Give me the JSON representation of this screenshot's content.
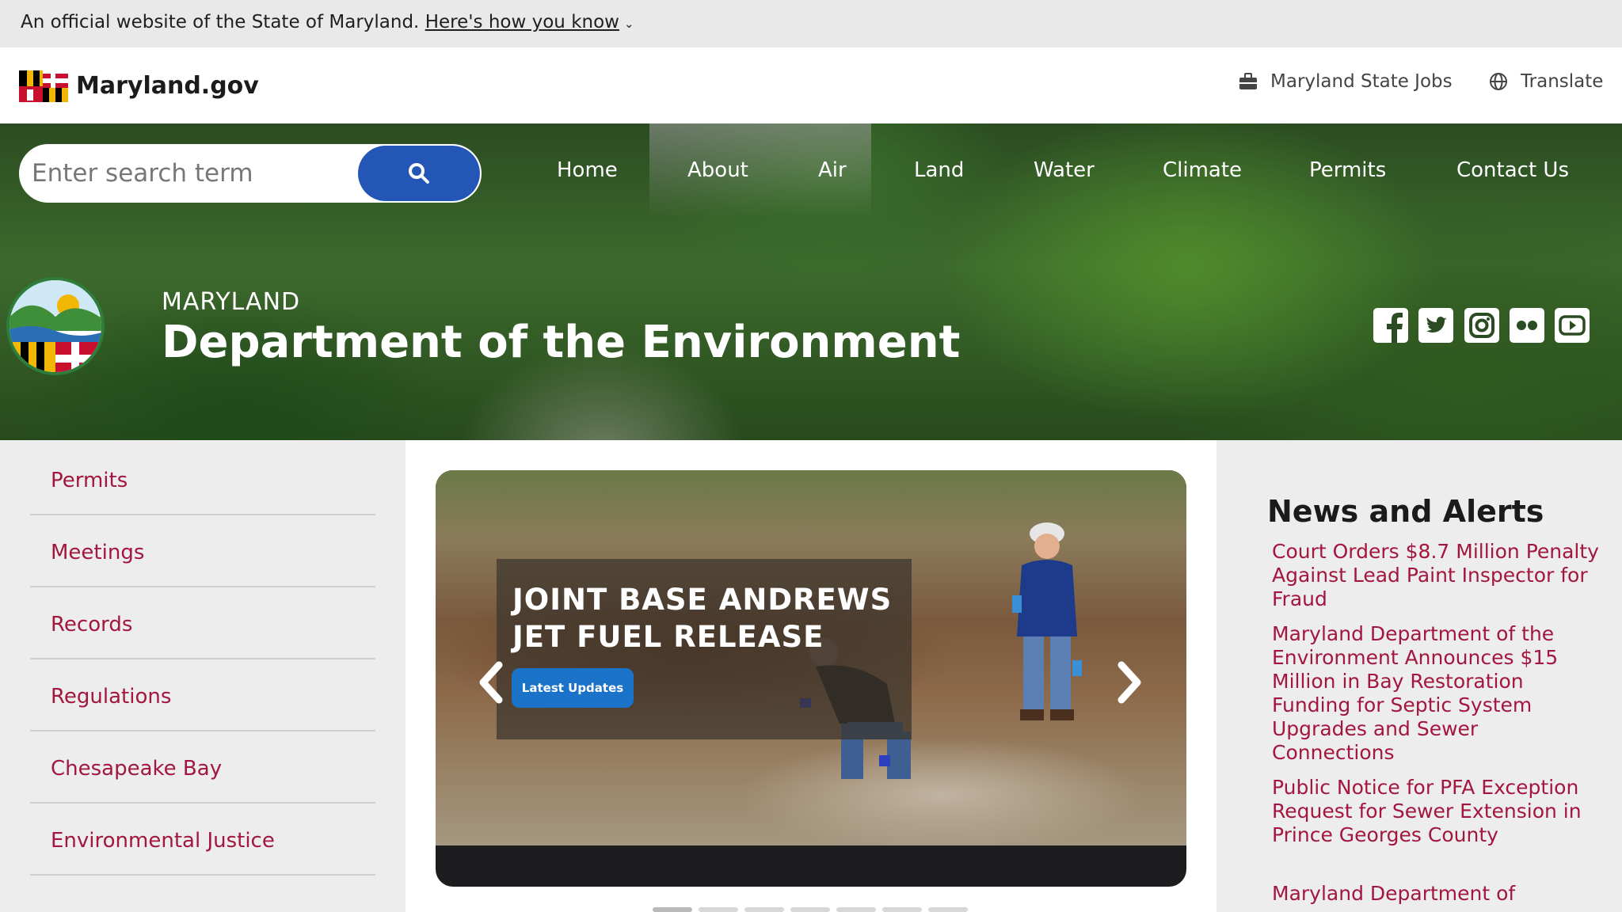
{
  "official_banner": {
    "text": "An official website of the State of Maryland.",
    "link_label": "Here's how you know",
    "chevron": "⌄"
  },
  "header": {
    "site_title": "Maryland.gov",
    "jobs_label": "Maryland State Jobs",
    "translate_label": "Translate",
    "icons": {
      "jobs": "briefcase-icon",
      "translate": "globe-icon",
      "logo": "maryland-flag-logo"
    }
  },
  "search": {
    "placeholder": "Enter search term",
    "button_icon": "search-icon"
  },
  "nav": {
    "items": [
      {
        "label": "Home"
      },
      {
        "label": "About"
      },
      {
        "label": "Air"
      },
      {
        "label": "Land"
      },
      {
        "label": "Water"
      },
      {
        "label": "Climate"
      },
      {
        "label": "Permits"
      },
      {
        "label": "Contact Us"
      }
    ]
  },
  "department": {
    "kicker": "MARYLAND",
    "title": "Department of the Environment",
    "seal": "mde-seal-logo"
  },
  "social": [
    "facebook-icon",
    "twitter-icon",
    "instagram-icon",
    "flickr-icon",
    "youtube-icon"
  ],
  "sidebar": {
    "items": [
      {
        "label": "Permits"
      },
      {
        "label": "Meetings"
      },
      {
        "label": "Records"
      },
      {
        "label": "Regulations"
      },
      {
        "label": "Chesapeake Bay"
      },
      {
        "label": "Environmental Justice"
      }
    ]
  },
  "carousel": {
    "caption_line1": "JOINT BASE ANDREWS",
    "caption_line2": "JET FUEL RELEASE",
    "button_label": "Latest Updates",
    "slide_count": 7,
    "active_index": 0
  },
  "news": {
    "title": "News and Alerts",
    "items": [
      {
        "headline": "Court Orders $8.7 Million Penalty Against Lead Paint Inspector for Fraud"
      },
      {
        "headline": "Maryland Department of the Environment Announces $15 Million in Bay Restoration Funding for Septic System Upgrades and Sewer Connections"
      },
      {
        "headline": "Public Notice for PFA Exception Request for Sewer Extension in Prince Georges County"
      },
      {
        "headline": "Maryland Department of"
      }
    ]
  },
  "colors": {
    "accent_blue": "#2456b8",
    "link_maroon": "#a3163f",
    "button_blue": "#1a73c8",
    "sidebar_bg": "#ededee"
  }
}
